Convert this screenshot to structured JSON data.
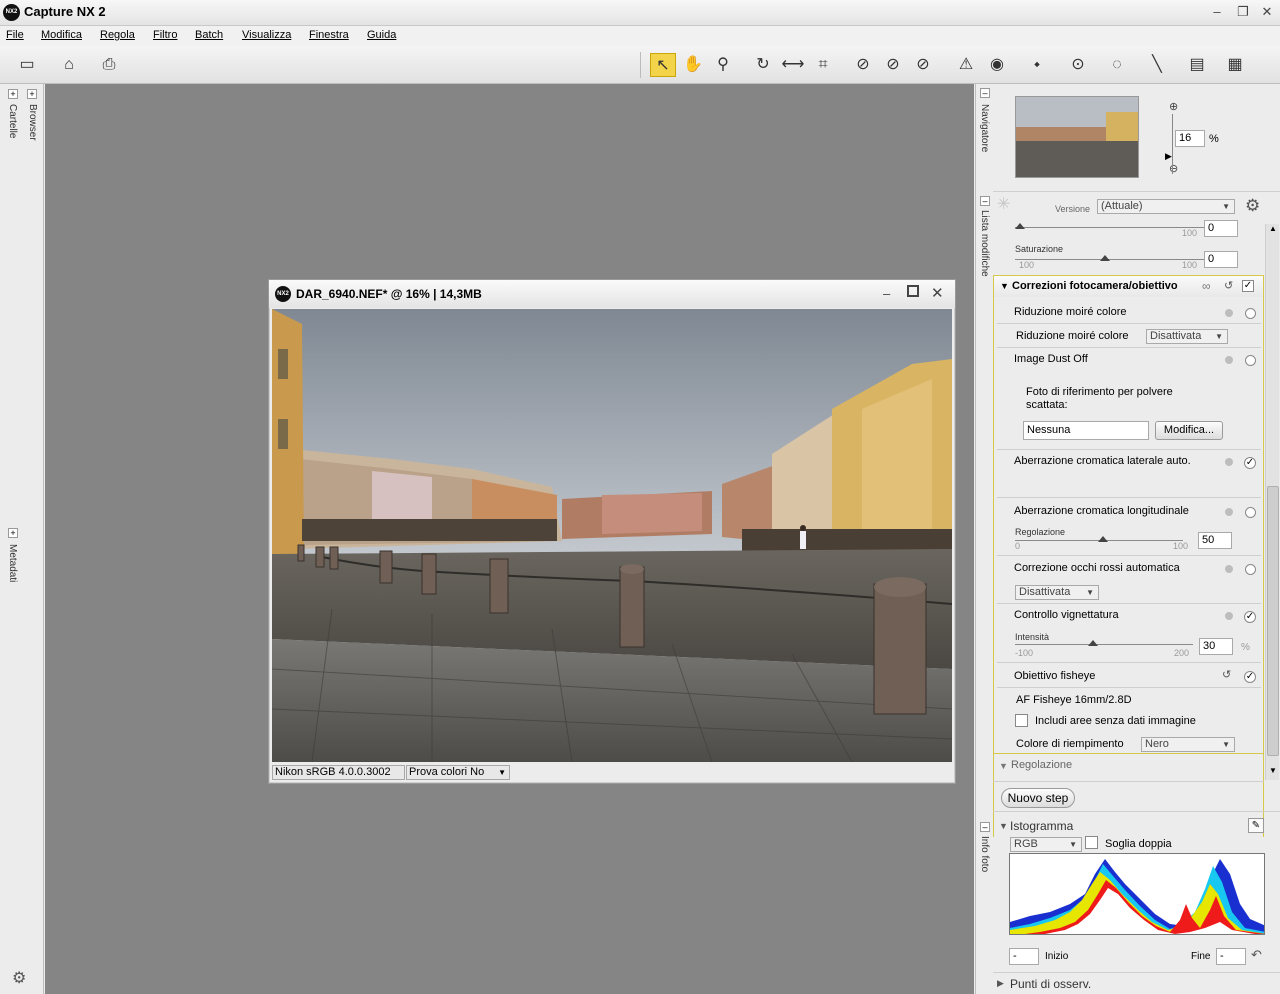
{
  "app": {
    "title": "Capture NX 2",
    "logo": "NX2"
  },
  "window_controls": {
    "minimize": "–",
    "restore": "❐",
    "close": "✕"
  },
  "menu": [
    "File",
    "Modifica",
    "Regola",
    "Filtro",
    "Batch",
    "Visualizza",
    "Finestra",
    "Guida"
  ],
  "left_panel": {
    "top_tab": "Cartelle",
    "browser_tab": "Browser",
    "bottom_tab": "Metadati"
  },
  "image_window": {
    "title": "DAR_6940.NEF* @ 16% | 14,3MB",
    "logo": "NX2",
    "color_profile": "Nikon sRGB 4.0.0.3002",
    "softproof": "Prova colori No"
  },
  "navigator": {
    "tab": "Navigatore",
    "zoom": "16",
    "zoom_unit": "%"
  },
  "edit_list": {
    "tab": "Lista modifiche",
    "version_label": "Versione",
    "version_value": "(Attuale)",
    "top_slider_value": "0",
    "top_slider_max": "100",
    "saturation_label": "Saturazione",
    "saturation_min": "100",
    "saturation_max": "100",
    "saturation_value": "0",
    "section_title": "Correzioni fotocamera/obiettivo",
    "moire_title": "Riduzione moiré colore",
    "moire_label": "Riduzione moiré colore",
    "moire_value": "Disattivata",
    "dust_title": "Image Dust Off",
    "dust_ref_label": "Foto di riferimento per polvere scattata:",
    "dust_ref_value": "Nessuna",
    "dust_button": "Modifica...",
    "lateral_ca": "Aberrazione cromatica laterale auto.",
    "long_ca": "Aberrazione cromatica longitudinale",
    "long_ca_adjust_label": "Regolazione",
    "long_ca_min": "0",
    "long_ca_max": "100",
    "long_ca_value": "50",
    "redeye_title": "Correzione occhi rossi automatica",
    "redeye_value": "Disattivata",
    "vignette_title": "Controllo vignettatura",
    "vignette_label": "Intensità",
    "vignette_min": "-100",
    "vignette_max": "200",
    "vignette_value": "30",
    "vignette_unit": "%",
    "fisheye_title": "Obiettivo fisheye",
    "fisheye_lens": "AF Fisheye 16mm/2.8D",
    "fisheye_include": "Includi aree senza dati immagine",
    "fill_color_label": "Colore di riempimento",
    "fill_color_value": "Nero",
    "adjust_section": "Regolazione",
    "new_step": "Nuovo step"
  },
  "histogram": {
    "tab": "Info foto",
    "title": "Istogramma",
    "channel": "RGB",
    "double_threshold": "Soglia doppia",
    "start_label": "Inizio",
    "end_label": "Fine",
    "start_value": "-",
    "end_value": "-"
  },
  "watch_points": "Punti di osserv."
}
